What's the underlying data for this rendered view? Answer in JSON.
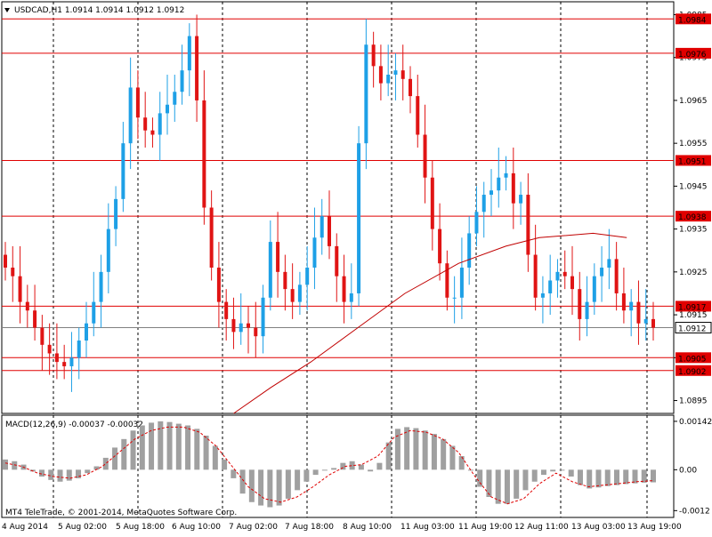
{
  "symbol_header": "USDCAD,H1  1.0914 1.0914 1.0912 1.0912",
  "macd_header": "MACD(12,26,9) -0.00037 -0.00032",
  "copyright": "MT4 TeleTrade, © 2001-2014, MetaQuotes Software Corp.",
  "colors": {
    "background": "#ffffff",
    "bull_candle": "#1ea0e6",
    "bear_candle": "#e01414",
    "level_line": "#e00000",
    "moving_average": "#c00000",
    "grid": "#000000",
    "macd_hist": "#a0a0a0",
    "signal_line": "#e00000",
    "label_bg": "#e00000"
  },
  "chart_data": [
    {
      "type": "candlestick",
      "symbol": "USDCAD",
      "timeframe": "H1",
      "ylim": [
        1.0892,
        1.0988
      ],
      "grid": "vertical dotted",
      "y_ticks": [
        "1.0985",
        "1.0975",
        "1.0965",
        "1.0955",
        "1.0945",
        "1.0935",
        "1.0925",
        "1.0915",
        "1.0905",
        "1.0895"
      ],
      "x_ticks": [
        "4 Aug 2014",
        "5 Aug 02:00",
        "5 Aug 18:00",
        "6 Aug 10:00",
        "7 Aug 02:00",
        "7 Aug 18:00",
        "8 Aug 10:00",
        "11 Aug 03:00",
        "11 Aug 19:00",
        "12 Aug 11:00",
        "13 Aug 03:00",
        "13 Aug 19:00"
      ],
      "horizontal_levels": [
        {
          "value": 1.0984,
          "label": "1.0984"
        },
        {
          "value": 1.0976,
          "label": "1.0976"
        },
        {
          "value": 1.0951,
          "label": "1.0951"
        },
        {
          "value": 1.0938,
          "label": "1.0938"
        },
        {
          "value": 1.0917,
          "label": "1.0917"
        },
        {
          "value": 1.0905,
          "label": "1.0905"
        },
        {
          "value": 1.0902,
          "label": "1.0902"
        }
      ],
      "current_price": {
        "value": 1.0912,
        "label": "1.0912"
      },
      "close_series": [
        1.0926,
        1.0924,
        1.0918,
        1.0916,
        1.0912,
        1.0908,
        1.0906,
        1.0904,
        1.0903,
        1.0905,
        1.0909,
        1.0913,
        1.0918,
        1.0925,
        1.0935,
        1.0942,
        1.0955,
        1.0968,
        1.0961,
        1.0958,
        1.0957,
        1.0962,
        1.0964,
        1.0967,
        1.0972,
        1.098,
        1.0965,
        1.094,
        1.0926,
        1.0918,
        1.0914,
        1.0911,
        1.0913,
        1.0912,
        1.091,
        1.0919,
        1.0932,
        1.0925,
        1.0921,
        1.0918,
        1.0922,
        1.0926,
        1.0933,
        1.0938,
        1.0931,
        1.0924,
        1.0918,
        1.092,
        1.0955,
        1.0978,
        1.0973,
        1.0969,
        1.0971,
        1.0972,
        1.097,
        1.0966,
        1.0957,
        1.0947,
        1.0935,
        1.0927,
        1.0919,
        1.0919,
        1.0926,
        1.0934,
        1.0939,
        1.0943,
        1.0944,
        1.0947,
        1.0948,
        1.0941,
        1.0943,
        1.0929,
        1.0919,
        1.092,
        1.0923,
        1.0925,
        1.0924,
        1.0921,
        1.0914,
        1.0918,
        1.0924,
        1.0926,
        1.0928,
        1.092,
        1.0916,
        1.0918,
        1.0913,
        1.0914,
        1.0912
      ],
      "moving_average": [
        {
          "x": 0.345,
          "y": 1.0892
        },
        {
          "x": 0.4,
          "y": 1.0898
        },
        {
          "x": 0.46,
          "y": 1.0904
        },
        {
          "x": 0.53,
          "y": 1.0912
        },
        {
          "x": 0.6,
          "y": 1.092
        },
        {
          "x": 0.68,
          "y": 1.0927
        },
        {
          "x": 0.75,
          "y": 1.0931
        },
        {
          "x": 0.8,
          "y": 1.0933
        },
        {
          "x": 0.88,
          "y": 1.0934
        },
        {
          "x": 0.93,
          "y": 1.0933
        }
      ]
    },
    {
      "type": "bar",
      "name": "MACD(12,26,9)",
      "ylim": [
        -0.0014,
        0.0016
      ],
      "y_ticks": [
        "0.00142",
        "0.00",
        "-0.0012"
      ],
      "histogram_main": [
        0.0003,
        0.00025,
        0.00015,
        -5e-05,
        -0.0002,
        -0.0003,
        -0.00035,
        -0.00032,
        -0.00025,
        -0.0001,
        0.0001,
        0.00035,
        0.00065,
        0.0009,
        0.00115,
        0.0013,
        0.00138,
        0.00142,
        0.0014,
        0.00135,
        0.0013,
        0.0012,
        0.001,
        0.0007,
        0.0003,
        -0.00025,
        -0.0007,
        -0.00095,
        -0.00105,
        -0.0011,
        -0.00105,
        -0.00085,
        -0.0006,
        -0.00035,
        -0.00015,
        0.0,
        5e-05,
        0.0002,
        0.00025,
        0.00015,
        -5e-05,
        0.0002,
        0.0008,
        0.0012,
        0.00125,
        0.00122,
        0.00115,
        0.00105,
        0.0009,
        0.0007,
        0.0004,
        0.0,
        -0.0005,
        -0.0008,
        -0.001,
        -0.001,
        -0.00085,
        -0.0006,
        -0.00035,
        -0.00015,
        -5e-05,
        0.0,
        -0.0002,
        -0.00045,
        -0.00055,
        -0.00052,
        -0.00048,
        -0.00045,
        -0.00042,
        -0.0004,
        -0.00038,
        -0.00037
      ],
      "signal_line": [
        0.0002,
        0.0001,
        -0.0001,
        -0.0002,
        -0.00025,
        -0.00015,
        0.0001,
        0.0005,
        0.0009,
        0.00115,
        0.00125,
        0.00125,
        0.0011,
        0.0007,
        0.0001,
        -0.0005,
        -0.00085,
        -0.00095,
        -0.0008,
        -0.0005,
        -0.00015,
        0.0001,
        0.00015,
        0.0004,
        0.00095,
        0.00115,
        0.0011,
        0.0009,
        0.0005,
        -0.0002,
        -0.0008,
        -0.001,
        -0.00085,
        -0.0004,
        -0.0001,
        -0.00035,
        -0.0005,
        -0.00045,
        -0.0004,
        -0.00035,
        -0.00032
      ]
    }
  ]
}
